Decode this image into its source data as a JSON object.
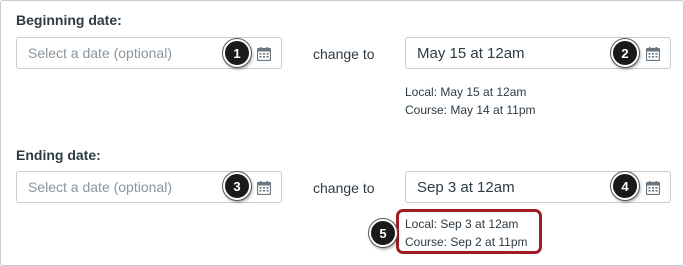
{
  "beginning": {
    "label": "Beginning date:",
    "input_placeholder": "Select a date (optional)",
    "change_to": "change to",
    "new_value": "May 15 at 12am",
    "local": "Local: May 15 at 12am",
    "course": "Course: May 14 at 11pm"
  },
  "ending": {
    "label": "Ending date:",
    "input_placeholder": "Select a date (optional)",
    "change_to": "change to",
    "new_value": "Sep 3 at 12am",
    "local": "Local: Sep 3 at 12am",
    "course": "Course: Sep 2 at 11pm"
  },
  "callouts": [
    "1",
    "2",
    "3",
    "4",
    "5"
  ],
  "colors": {
    "highlight": "#a11d26",
    "callout_bg": "#1a1a1a",
    "text": "#2d3b45",
    "border": "#c7cdd1"
  },
  "icons": {
    "calendar": "calendar-icon"
  }
}
